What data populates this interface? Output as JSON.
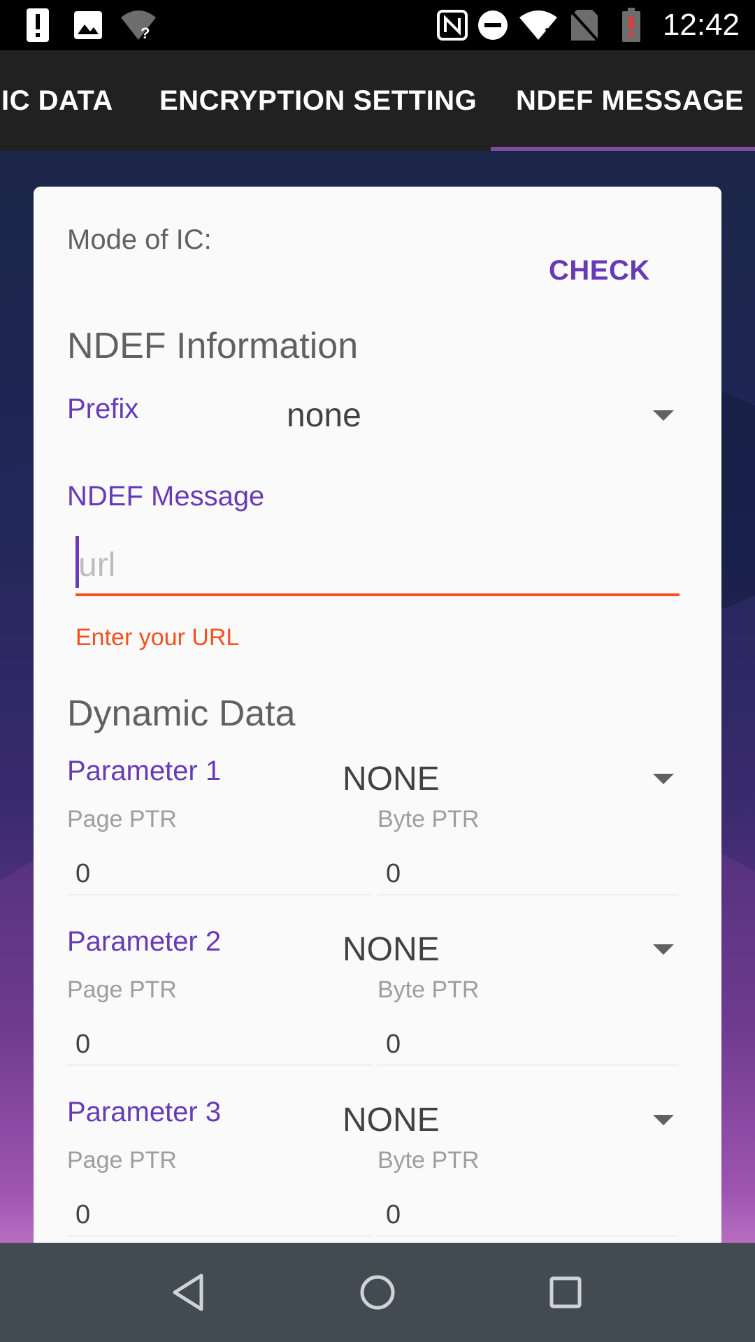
{
  "status_bar": {
    "time": "12:42",
    "icons": [
      "alert-icon",
      "image-icon",
      "wifi-question-icon",
      "nfc-icon",
      "dnd-icon",
      "wifi-icon",
      "no-sim-icon",
      "battery-alert-icon"
    ]
  },
  "tabs": [
    {
      "label": "IC DATA",
      "active": false
    },
    {
      "label": "ENCRYPTION SETTING",
      "active": false
    },
    {
      "label": "NDEF MESSAGE",
      "active": true
    }
  ],
  "card": {
    "mode_label": "Mode of IC:",
    "check_button": "CHECK",
    "ndef_info_title": "NDEF Information",
    "prefix_label": "Prefix",
    "prefix_value": "none",
    "ndef_message_label": "NDEF Message",
    "url_placeholder": "url",
    "url_value": "",
    "url_error": "Enter your URL",
    "dynamic_title": "Dynamic Data",
    "parameters": [
      {
        "label": "Parameter 1",
        "value": "NONE",
        "page_ptr_label": "Page PTR",
        "byte_ptr_label": "Byte PTR",
        "page_ptr": "0",
        "byte_ptr": "0"
      },
      {
        "label": "Parameter 2",
        "value": "NONE",
        "page_ptr_label": "Page PTR",
        "byte_ptr_label": "Byte PTR",
        "page_ptr": "0",
        "byte_ptr": "0"
      },
      {
        "label": "Parameter 3",
        "value": "NONE",
        "page_ptr_label": "Page PTR",
        "byte_ptr_label": "Byte PTR",
        "page_ptr": "0",
        "byte_ptr": "0"
      }
    ]
  },
  "colors": {
    "accent": "#673ab7",
    "error": "#f4511e",
    "tab_indicator": "#7c4d9e",
    "toolbar": "#212121",
    "nav_bar": "#424a52"
  },
  "nav_bar": {
    "icons": [
      "back-icon",
      "home-icon",
      "recents-icon"
    ]
  }
}
